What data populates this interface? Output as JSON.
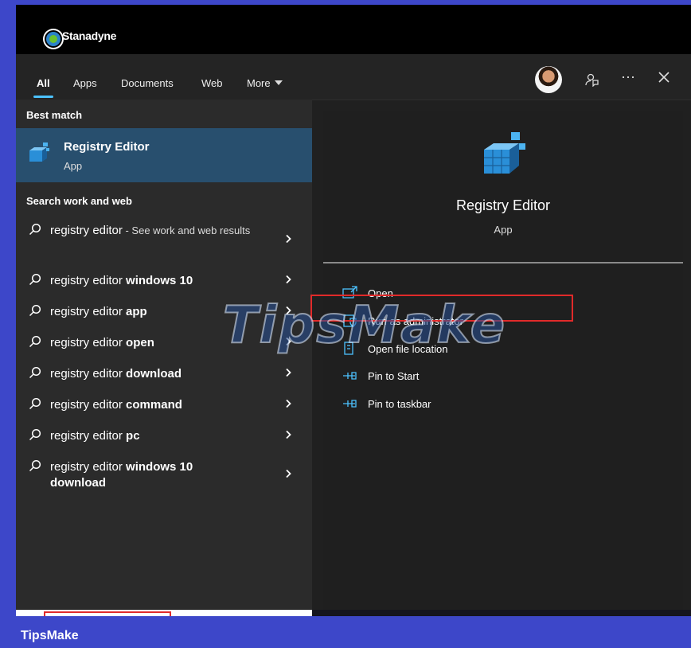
{
  "brand": {
    "name": "Stanadyne"
  },
  "tabs": [
    {
      "label": "All",
      "active": true
    },
    {
      "label": "Apps"
    },
    {
      "label": "Documents"
    },
    {
      "label": "Web"
    },
    {
      "label": "More"
    }
  ],
  "toolbar": {
    "feedback_icon": "feedback-icon",
    "more_icon": "ellipsis-icon",
    "close_icon": "close-icon"
  },
  "best_match": {
    "section_title": "Best match",
    "title": "Registry Editor",
    "subtitle": "App"
  },
  "search_web": {
    "section_title": "Search work and web",
    "items": [
      {
        "prefix": "registry editor",
        "bold": "",
        "suffix": " - See work and web results"
      },
      {
        "prefix": "registry editor ",
        "bold": "windows 10",
        "suffix": ""
      },
      {
        "prefix": "registry editor ",
        "bold": "app",
        "suffix": ""
      },
      {
        "prefix": "registry editor ",
        "bold": "open",
        "suffix": ""
      },
      {
        "prefix": "registry editor ",
        "bold": "download",
        "suffix": ""
      },
      {
        "prefix": "registry editor ",
        "bold": "command",
        "suffix": ""
      },
      {
        "prefix": "registry editor ",
        "bold": "pc",
        "suffix": ""
      },
      {
        "prefix": "registry editor ",
        "bold": "windows 10 download",
        "suffix": ""
      }
    ]
  },
  "details": {
    "title": "Registry Editor",
    "subtitle": "App",
    "actions": [
      {
        "label": "Open",
        "icon": "open-icon"
      },
      {
        "label": "Run as administrator",
        "icon": "shield-icon"
      },
      {
        "label": "Open file location",
        "icon": "folder-icon"
      },
      {
        "label": "Pin to Start",
        "icon": "pin-icon"
      },
      {
        "label": "Pin to taskbar",
        "icon": "pin-icon"
      }
    ]
  },
  "watermark": "TipsMake",
  "footer": {
    "label": "TipsMake"
  },
  "colors": {
    "accent": "#4cc2ff",
    "selected_row": "#284f6e",
    "highlight_red": "#e12a2a",
    "background": "#3d47c9"
  }
}
